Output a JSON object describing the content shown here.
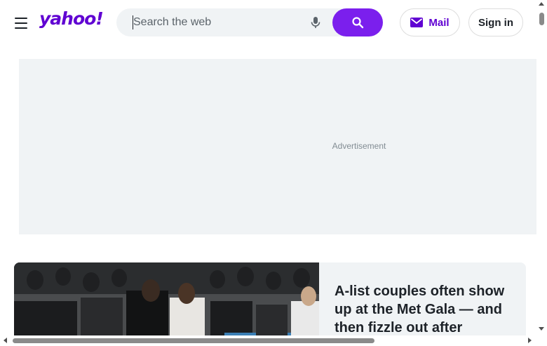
{
  "header": {
    "logo_text": "yahoo!",
    "brand_color": "#6001d2",
    "search": {
      "placeholder": "Search the web",
      "value": ""
    },
    "mail_label": "Mail",
    "signin_label": "Sign in",
    "icons": {
      "menu": "menu-icon",
      "mic": "microphone-icon",
      "search": "search-icon",
      "mail": "envelope-icon"
    }
  },
  "ad": {
    "label": "Advertisement"
  },
  "article": {
    "title": "A-list couples often show up at the Met Gala — and then fizzle out after"
  },
  "colors": {
    "accent": "#7b1fed",
    "surface": "#f0f3f5",
    "text": "#1d2228"
  }
}
